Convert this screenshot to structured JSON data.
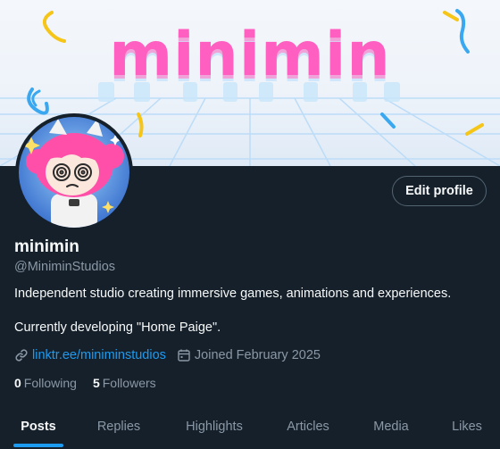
{
  "banner": {
    "title": "minimin",
    "colors": {
      "title": "#ff5fc0",
      "sky": "#f4f7fb",
      "grid": "#bcdcf7",
      "confetti_yellow": "#f5c518",
      "confetti_blue": "#3aa8f0"
    }
  },
  "avatar": {
    "alt": "minimin character avatar"
  },
  "actions": {
    "edit_profile": "Edit profile"
  },
  "profile": {
    "display_name": "minimin",
    "handle": "@MiniminStudios",
    "bio": "Independent studio creating immersive games, animations and experiences.",
    "bio_line2": "Currently developing \"Home Paige\".",
    "link": "linktr.ee/miniminstudios",
    "link_icon": "link-icon",
    "joined": "Joined February 2025",
    "joined_icon": "calendar-icon"
  },
  "stats": {
    "following_count": "0",
    "following_label": "Following",
    "followers_count": "5",
    "followers_label": "Followers"
  },
  "tabs": [
    {
      "label": "Posts",
      "active": true
    },
    {
      "label": "Replies",
      "active": false
    },
    {
      "label": "Highlights",
      "active": false
    },
    {
      "label": "Articles",
      "active": false
    },
    {
      "label": "Media",
      "active": false
    },
    {
      "label": "Likes",
      "active": false
    }
  ],
  "theme": {
    "background": "#15202b",
    "text": "#f7f9f9",
    "muted": "#8b98a5",
    "accent": "#1d9bf0"
  }
}
